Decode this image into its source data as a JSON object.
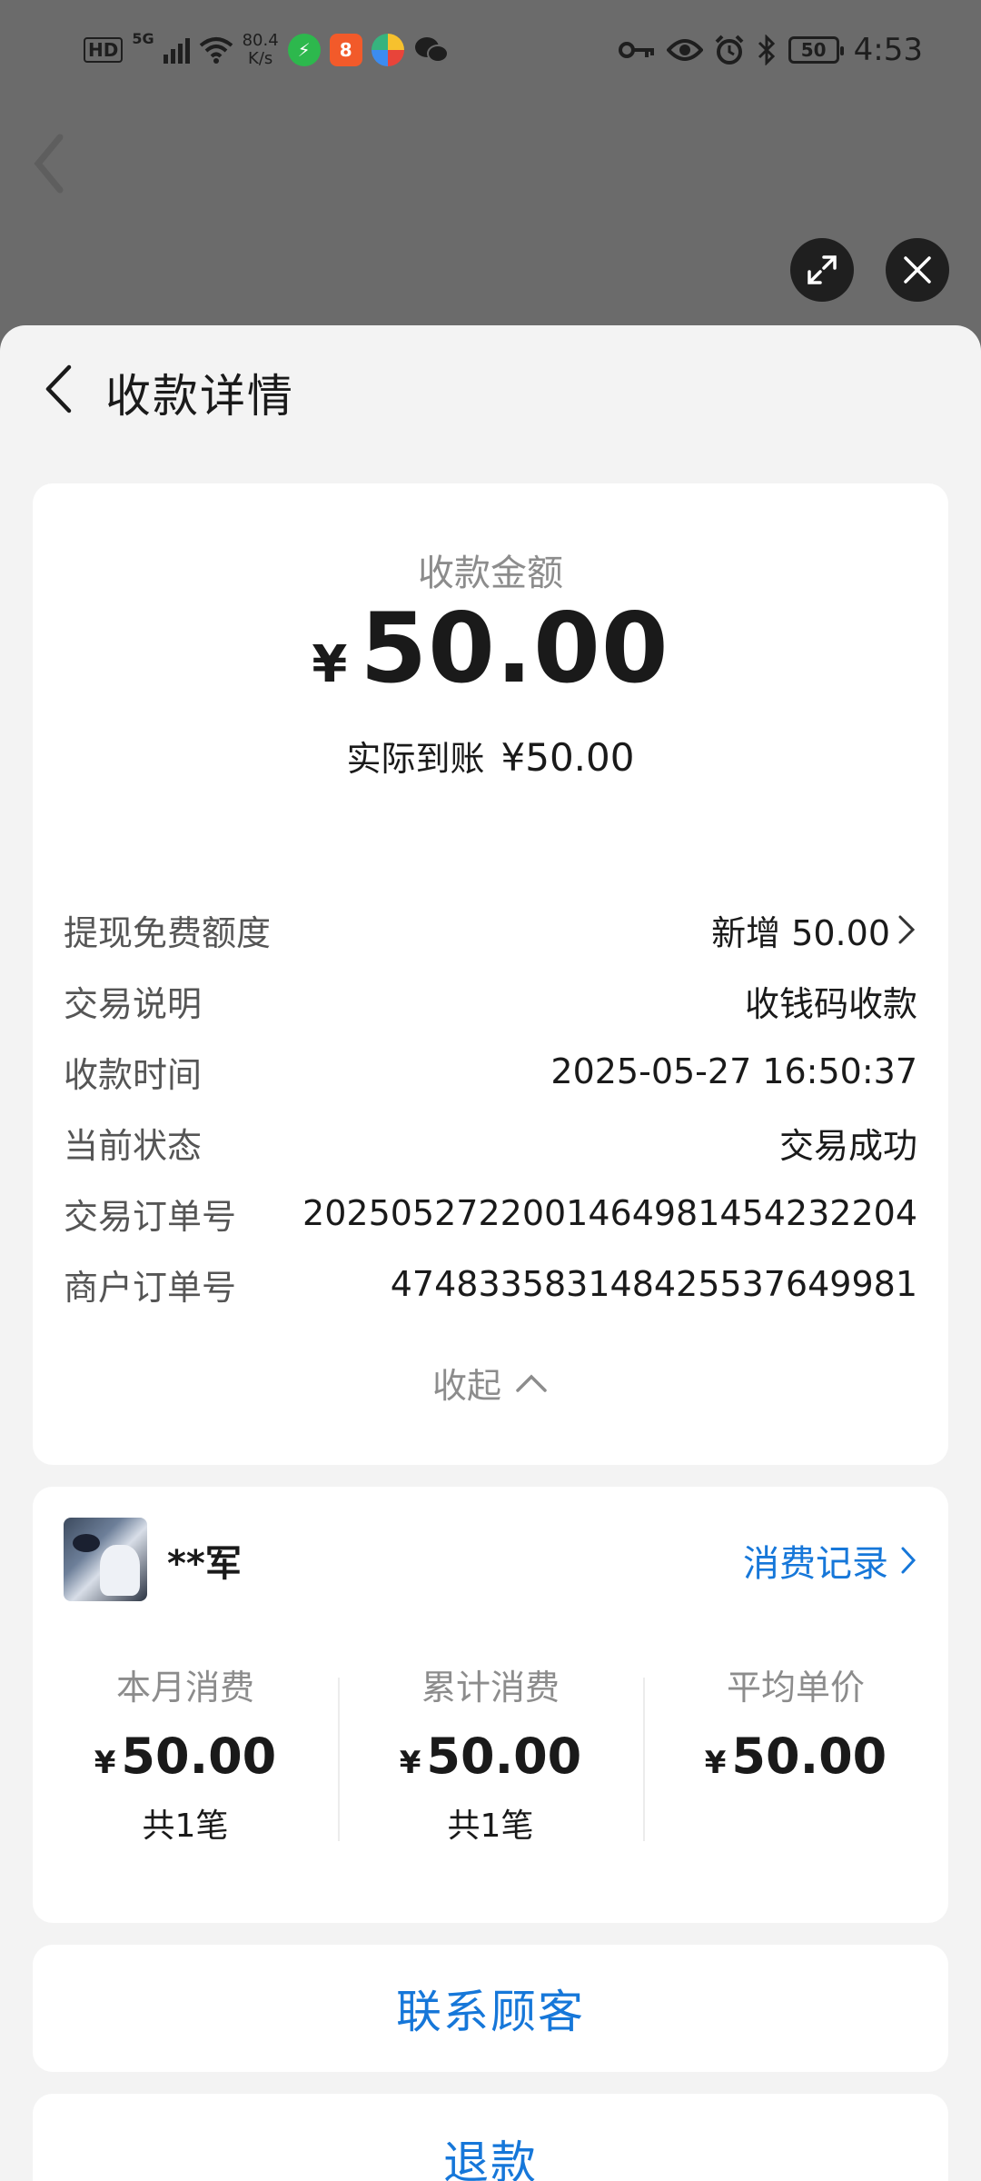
{
  "status_bar": {
    "hd": "HD",
    "network": "5G",
    "speed_top": "80.4",
    "speed_bottom": "K/s",
    "battery": "50",
    "time": "4:53"
  },
  "header": {
    "title": "收款详情"
  },
  "amount": {
    "label": "收款金额",
    "currency": "¥",
    "value": "50.00",
    "actual_label": "实际到账",
    "actual_value": "¥50.00"
  },
  "details": [
    {
      "label": "提现免费额度",
      "value": "新增 50.00"
    },
    {
      "label": "交易说明",
      "value": "收钱码收款"
    },
    {
      "label": "收款时间",
      "value": "2025-05-27 16:50:37"
    },
    {
      "label": "当前状态",
      "value": "交易成功"
    },
    {
      "label": "交易订单号",
      "value": "2025052722001464981454232204"
    },
    {
      "label": "商户订单号",
      "value": "474833583148425537649981"
    }
  ],
  "collapse_label": "收起",
  "customer": {
    "name": "**军",
    "history_link": "消费记录",
    "stats": [
      {
        "label": "本月消费",
        "currency": "¥",
        "value": "50.00",
        "count": "共1笔"
      },
      {
        "label": "累计消费",
        "currency": "¥",
        "value": "50.00",
        "count": "共1笔"
      },
      {
        "label": "平均单价",
        "currency": "¥",
        "value": "50.00",
        "count": ""
      }
    ]
  },
  "buttons": {
    "contact": "联系顾客",
    "refund": "退款"
  },
  "colors": {
    "link_blue": "#1677d9",
    "overlay": "#6b6b6b",
    "sheet_bg": "#f3f3f3"
  }
}
